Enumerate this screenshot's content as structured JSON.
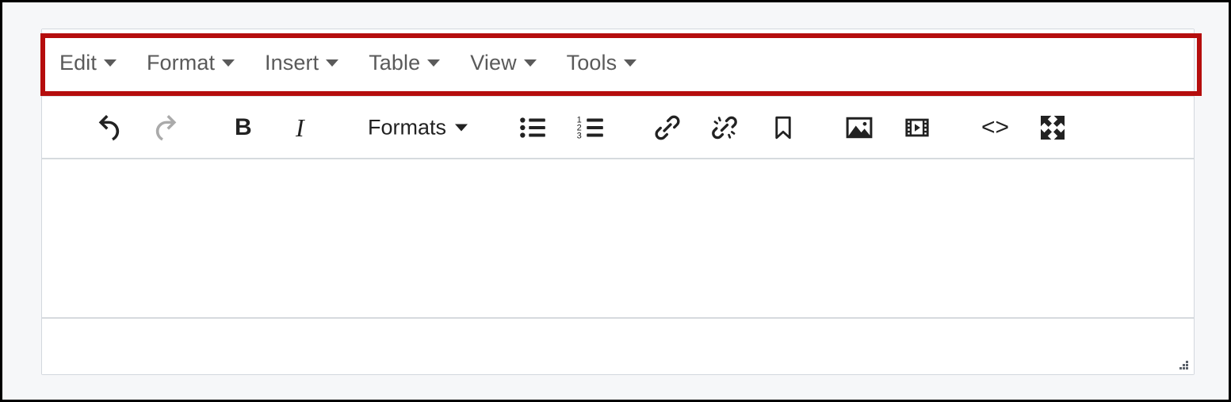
{
  "app": {
    "name": "rich-text-editor",
    "accent_highlight_color": "#b50d0d",
    "panel_border_color": "#d3d8de",
    "page_background_color": "#f6f7f9"
  },
  "menubar": {
    "items": [
      {
        "label": "Edit",
        "caret": "chevron-down-icon"
      },
      {
        "label": "Format",
        "caret": "chevron-down-icon"
      },
      {
        "label": "Insert",
        "caret": "chevron-down-icon"
      },
      {
        "label": "Table",
        "caret": "chevron-down-icon"
      },
      {
        "label": "View",
        "caret": "chevron-down-icon"
      },
      {
        "label": "Tools",
        "caret": "chevron-down-icon"
      }
    ]
  },
  "toolbar": {
    "formats_label": "Formats",
    "bold_label": "B",
    "italic_label": "I",
    "code_label": "<>",
    "buttons": [
      {
        "name": "undo-icon",
        "state": "enabled"
      },
      {
        "name": "redo-icon",
        "state": "disabled"
      },
      {
        "name": "bold-icon",
        "state": "enabled"
      },
      {
        "name": "italic-icon",
        "state": "enabled"
      },
      {
        "name": "formats-dropdown",
        "state": "enabled"
      },
      {
        "name": "bullet-list-icon",
        "state": "enabled"
      },
      {
        "name": "numbered-list-icon",
        "state": "enabled"
      },
      {
        "name": "link-icon",
        "state": "enabled"
      },
      {
        "name": "unlink-icon",
        "state": "enabled"
      },
      {
        "name": "bookmark-icon",
        "state": "enabled"
      },
      {
        "name": "image-icon",
        "state": "enabled"
      },
      {
        "name": "media-icon",
        "state": "enabled"
      },
      {
        "name": "source-code-icon",
        "state": "enabled"
      },
      {
        "name": "fullscreen-icon",
        "state": "enabled"
      }
    ]
  },
  "content": {
    "body_text": "",
    "placeholder": ""
  },
  "statusbar": {
    "text": "",
    "resize_handle": "resize-grip-icon"
  }
}
